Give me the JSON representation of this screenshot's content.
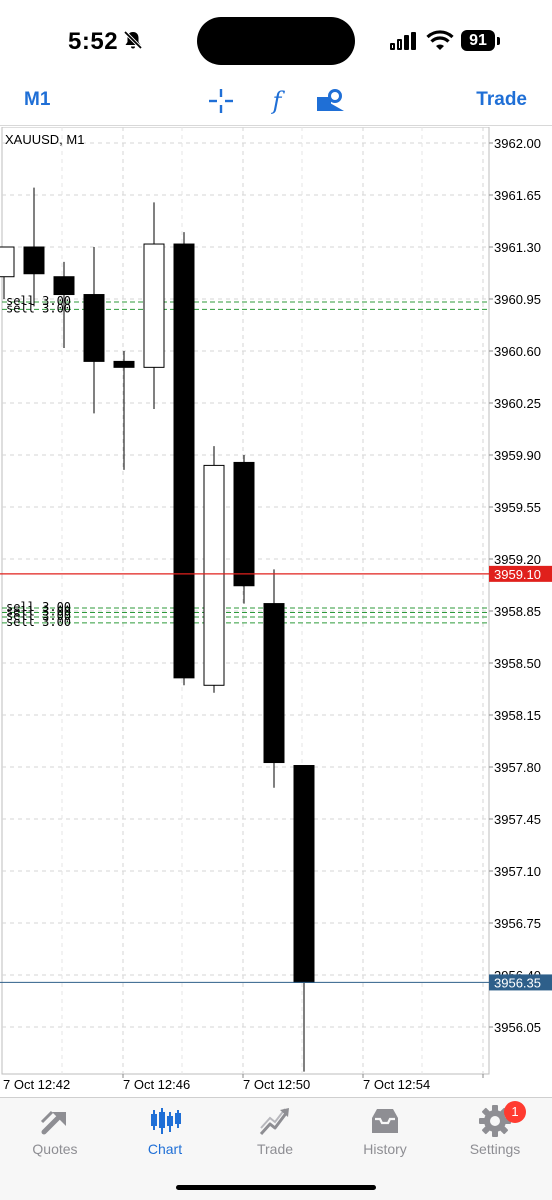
{
  "status_bar": {
    "time": "5:52",
    "battery": "91"
  },
  "toolbar": {
    "timeframe": "M1",
    "trade": "Trade"
  },
  "chart": {
    "symbol_label": "XAUUSD, M1",
    "price_axis": [
      "3962.00",
      "3961.65",
      "3961.30",
      "3960.95",
      "3960.60",
      "3960.25",
      "3959.90",
      "3959.55",
      "3959.20",
      "3958.85",
      "3958.50",
      "3958.15",
      "3957.80",
      "3957.45",
      "3957.10",
      "3956.75",
      "3956.40",
      "3956.05"
    ],
    "time_axis": [
      "7 Oct 12:42",
      "7 Oct 12:46",
      "7 Oct 12:50",
      "7 Oct 12:54"
    ],
    "bid_price": "3956.35",
    "ask_price": "3959.10",
    "colors": {
      "ask_line": "#e0201c",
      "bid_line": "#2e5f8a",
      "order_line": "#2c9a3a"
    }
  },
  "chart_data": {
    "type": "candlestick",
    "title": "XAUUSD, M1",
    "ylim": [
      3955.6,
      3962.15
    ],
    "candles": [
      {
        "open": 3961.1,
        "high": 3961.3,
        "low": 3960.95,
        "close": 3961.3
      },
      {
        "open": 3961.3,
        "high": 3961.7,
        "low": 3960.9,
        "close": 3961.12
      },
      {
        "open": 3961.1,
        "high": 3961.2,
        "low": 3960.62,
        "close": 3960.98
      },
      {
        "open": 3960.98,
        "high": 3961.3,
        "low": 3960.18,
        "close": 3960.53
      },
      {
        "open": 3960.53,
        "high": 3960.6,
        "low": 3959.8,
        "close": 3960.49
      },
      {
        "open": 3960.49,
        "high": 3961.6,
        "low": 3960.21,
        "close": 3961.32
      },
      {
        "open": 3961.32,
        "high": 3961.4,
        "low": 3958.35,
        "close": 3958.4
      },
      {
        "open": 3958.35,
        "high": 3959.96,
        "low": 3958.3,
        "close": 3959.83
      },
      {
        "open": 3959.85,
        "high": 3959.9,
        "low": 3958.9,
        "close": 3959.02
      },
      {
        "open": 3958.9,
        "high": 3959.13,
        "low": 3957.66,
        "close": 3957.83
      },
      {
        "open": 3957.81,
        "high": 3957.81,
        "low": 3955.75,
        "close": 3956.35
      }
    ],
    "orders": [
      {
        "label": "sell 3.00",
        "price": 3960.93
      },
      {
        "label": "sell 3.00",
        "price": 3960.88
      },
      {
        "label": "sell 3.00",
        "price": 3958.87
      },
      {
        "label": "sell 3.00",
        "price": 3958.84
      },
      {
        "label": "sell 3.00",
        "price": 3958.81
      },
      {
        "label": "sell 3.00",
        "price": 3958.77
      }
    ]
  },
  "tabs": [
    {
      "label": "Quotes",
      "icon": "quotes-icon"
    },
    {
      "label": "Chart",
      "icon": "chart-icon",
      "active": true
    },
    {
      "label": "Trade",
      "icon": "trade-icon"
    },
    {
      "label": "History",
      "icon": "history-icon"
    },
    {
      "label": "Settings",
      "icon": "settings-icon",
      "badge": "1"
    }
  ]
}
